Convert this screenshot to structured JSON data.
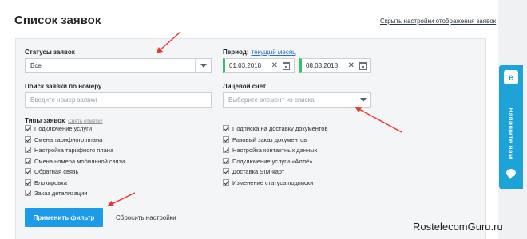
{
  "header": {
    "title": "Список заявок",
    "hide_settings_link": "Скрыть настройки отображения заявок"
  },
  "filters": {
    "status": {
      "label": "Статусы заявок",
      "value": "Все"
    },
    "period": {
      "label": "Период:",
      "quick_link": "текущий месяц",
      "from": "01.03.2018",
      "to": "08.03.2018"
    },
    "search": {
      "label": "Поиск заявки по номеру",
      "placeholder": "Введите номер заявки"
    },
    "account": {
      "label": "Лицевой счёт",
      "placeholder": "Выберите элемент из списка"
    },
    "types": {
      "label": "Типы заявок",
      "clear_link": "Снять отметку",
      "left": [
        "Подключение услуги",
        "Смена тарифного плана",
        "Настройка тарифного плана",
        "Смена номера мобильной связи",
        "Обратная связь",
        "Блокировка",
        "Заказ детализации"
      ],
      "right": [
        "Подписка на доставку документов",
        "Разовый заказ документов",
        "Настройка контактных данных",
        "Подключение услуги «Аллё»",
        "Доставка SIM-карт",
        "Изменение статуса подписки"
      ]
    },
    "apply_button": "Применить фильтр",
    "reset_link": "Сбросить настройки"
  },
  "side_widget": {
    "logo_letter": "e",
    "label": "Напишите нам"
  },
  "watermark": "RostelecomGuru.ru",
  "colors": {
    "accent_blue": "#1e9be8",
    "side_tab": "#1da3d8",
    "date_marker": "#36c26a",
    "annotation_arrow": "#e53935"
  }
}
